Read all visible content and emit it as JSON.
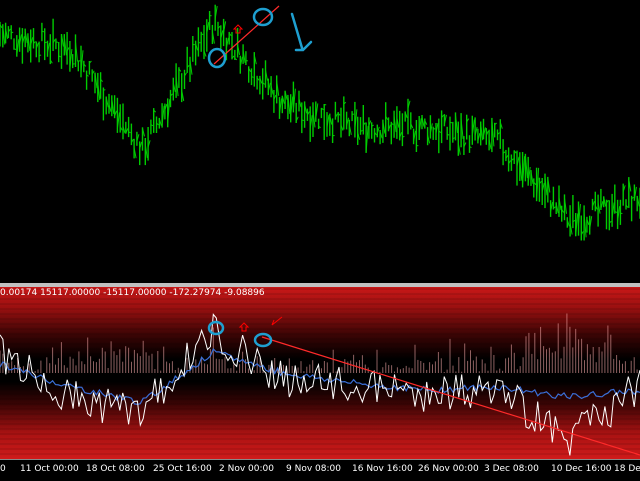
{
  "indicator": {
    "header_values": [
      "0.00174",
      "15117.00000",
      "-15117.00000",
      "-172.27974",
      "-9.08896"
    ]
  },
  "time_axis": {
    "labels": [
      "0",
      "11 Oct 00:00",
      "18 Oct 08:00",
      "25 Oct 16:00",
      "2 Nov 00:00",
      "9 Nov 08:00",
      "16 Nov 16:00",
      "26 Nov 00:00",
      "3 Dec 08:00",
      "10 Dec 16:00",
      "18 Dec 00"
    ]
  },
  "colors": {
    "bull_bars": "#00cc00",
    "annotation_blue": "#1e9fd0",
    "trendline_red": "#ff2a2a",
    "arrow_red": "#ff0000",
    "oscillator_line": "#ffffff",
    "signal_line": "#3a6fd8",
    "histogram": "#ffb0b0"
  },
  "icons": {
    "up_arrow": "up-arrow-icon",
    "circle_marker": "circle-marker-icon",
    "down_pointer": "down-pointer-annotation-icon"
  },
  "chart_data": [
    {
      "type": "bar",
      "subtype": "ohlc-price",
      "title": "",
      "x": [
        "11 Oct 00:00",
        "18 Oct 08:00",
        "25 Oct 16:00",
        "2 Nov 00:00",
        "9 Nov 08:00",
        "16 Nov 16:00",
        "26 Nov 00:00",
        "3 Dec 08:00",
        "10 Dec 16:00",
        "18 Dec 00"
      ],
      "series": [
        {
          "values": [
            0.88,
            0.83,
            0.47,
            0.92,
            0.63,
            0.55,
            0.55,
            0.5,
            0.22,
            0.3
          ]
        }
      ],
      "grid": false
    },
    {
      "type": "line",
      "subtype": "oscillator",
      "title": "",
      "x": [
        "11 Oct 00:00",
        "18 Oct 08:00",
        "25 Oct 16:00",
        "2 Nov 00:00",
        "9 Nov 08:00",
        "16 Nov 16:00",
        "26 Nov 00:00",
        "3 Dec 08:00",
        "10 Dec 16:00",
        "18 Dec 00"
      ],
      "series": [
        {
          "values": [
            0.62,
            0.35,
            0.28,
            0.74,
            0.46,
            0.42,
            0.38,
            0.4,
            0.12,
            0.42
          ]
        },
        {
          "values": [
            0.55,
            0.42,
            0.33,
            0.62,
            0.5,
            0.44,
            0.4,
            0.42,
            0.36,
            0.4
          ]
        }
      ],
      "grid": false
    }
  ]
}
